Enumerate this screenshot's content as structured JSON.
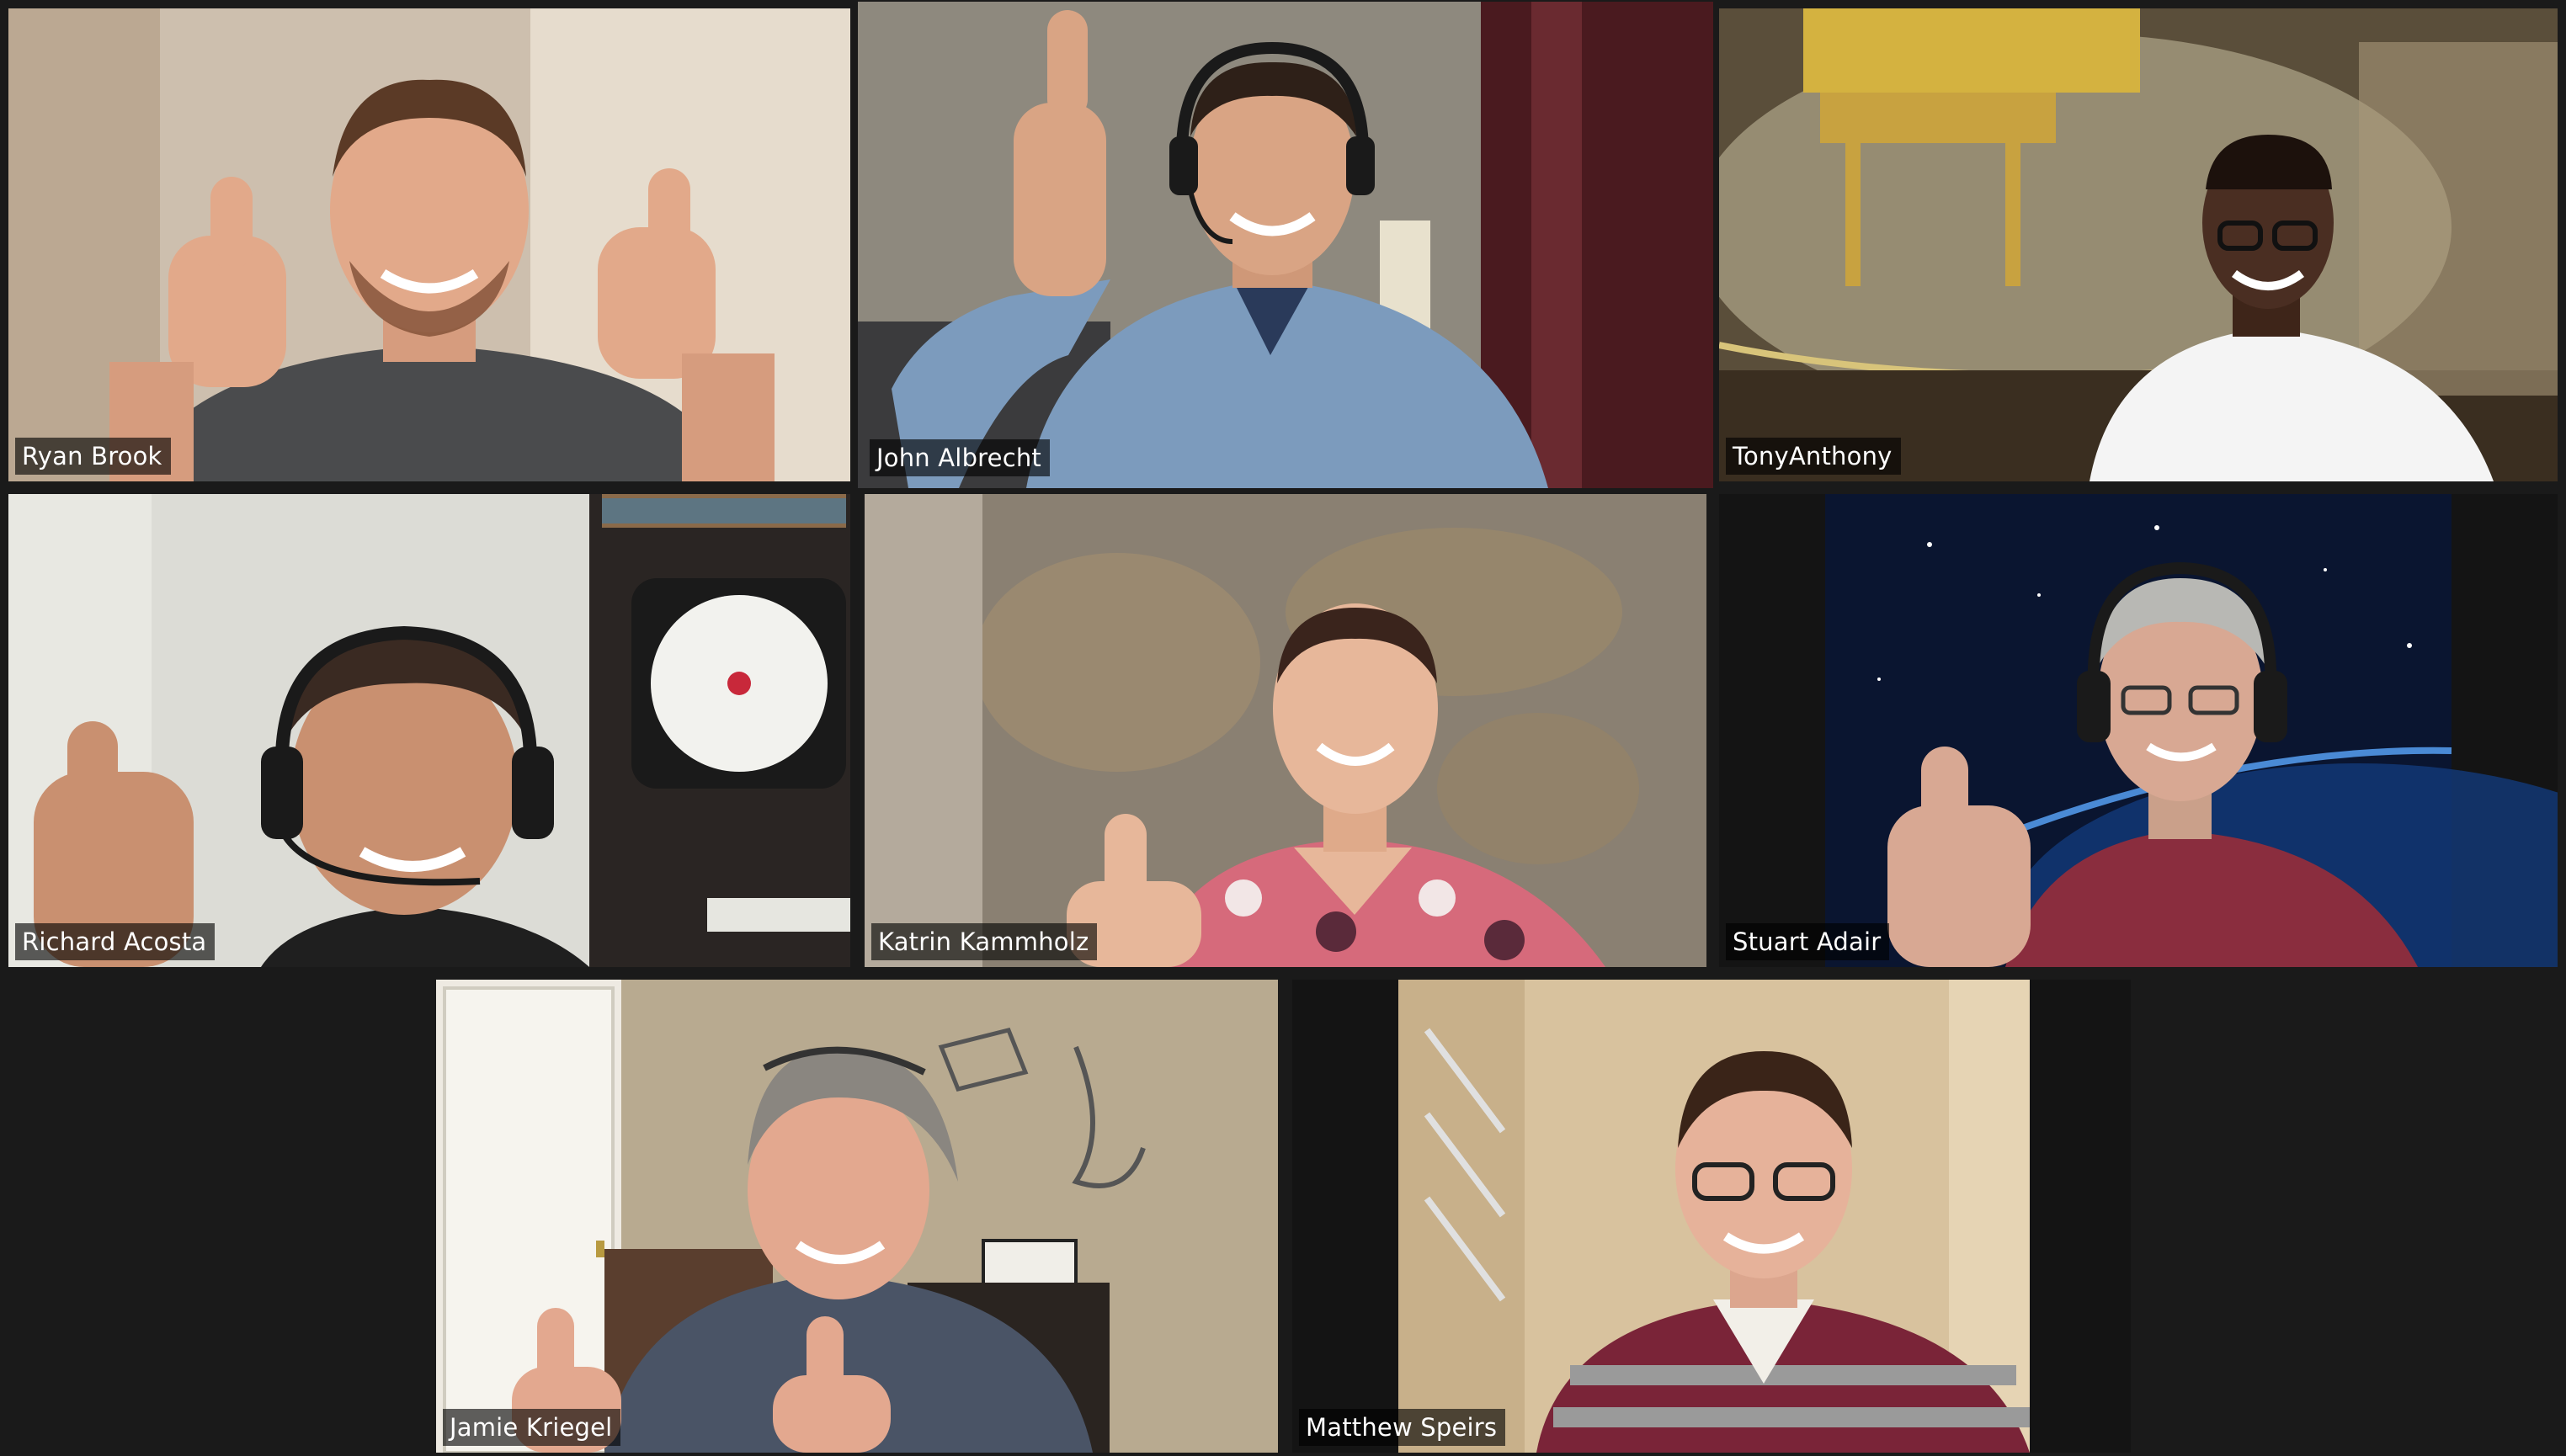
{
  "meeting": {
    "view": "gallery",
    "active_speaker_color": "#d4e86a",
    "participants": [
      {
        "name": "Ryan Brook",
        "active": false,
        "bg": "#c9b9a6",
        "skin": "#e2a98a",
        "shirt": "#4a4b4d",
        "accent": "#efe4d2",
        "gesture": "two-thumbs-up"
      },
      {
        "name": "John Albrecht",
        "active": true,
        "bg": "#8c877b",
        "skin": "#d9a484",
        "shirt": "#7c9bbd",
        "accent": "#5a1e24",
        "gesture": "thumbs-up-headset"
      },
      {
        "name": "TonyAnthony",
        "active": false,
        "bg": "#7a6a4a",
        "skin": "#4a2e22",
        "shirt": "#f4f4f4",
        "accent": "#c8a94a",
        "gesture": "smile-glasses"
      },
      {
        "name": "Richard Acosta",
        "active": false,
        "bg": "#d9d9d4",
        "skin": "#c99070",
        "shirt": "#1f1f1f",
        "accent": "#2a2523",
        "gesture": "thumbs-up-headset"
      },
      {
        "name": "Katrin Kammholz",
        "active": false,
        "bg": "#8a8072",
        "skin": "#e7b79a",
        "shirt": "#d66a7b",
        "accent": "#b09a78",
        "gesture": "thumbs-up"
      },
      {
        "name": "Stuart Adair",
        "active": false,
        "bg": "#0a1530",
        "skin": "#d8a893",
        "shirt": "#8a2d3e",
        "accent": "#1f5fb8",
        "gesture": "thumbs-up-headset"
      },
      {
        "name": "Jamie Kriegel",
        "active": false,
        "bg": "#b8aa90",
        "skin": "#e3a88f",
        "shirt": "#4a5466",
        "accent": "#ffffff",
        "gesture": "thumbs-up-glasses"
      },
      {
        "name": "Matthew Speirs",
        "active": false,
        "bg": "#d8c29e",
        "skin": "#e6b29a",
        "shirt": "#7a2438",
        "accent": "#f2efe8",
        "gesture": "smile-glasses"
      }
    ]
  }
}
